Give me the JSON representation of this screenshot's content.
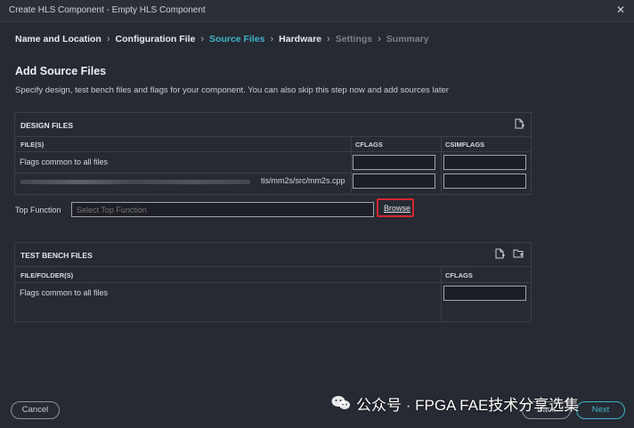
{
  "window": {
    "title": "Create HLS Component - Empty HLS Component"
  },
  "steps": [
    {
      "label": "Name and Location",
      "state": "done"
    },
    {
      "label": "Configuration File",
      "state": "done"
    },
    {
      "label": "Source Files",
      "state": "active"
    },
    {
      "label": "Hardware",
      "state": "done"
    },
    {
      "label": "Settings",
      "state": "pending"
    },
    {
      "label": "Summary",
      "state": "pending"
    }
  ],
  "page": {
    "title": "Add Source Files",
    "description": "Specify design, test bench files and flags for your component. You can also skip this step now and add sources later"
  },
  "design_files": {
    "title": "DESIGN FILES",
    "columns": [
      "FILE(S)",
      "CFLAGS",
      "CSIMFLAGS"
    ],
    "rows": [
      {
        "file": "Flags common to all files",
        "cflags": "",
        "csimflags": ""
      },
      {
        "file": "tis/mm2s/src/mm2s.cpp",
        "cflags": "",
        "csimflags": ""
      }
    ],
    "icon": "add-file-icon"
  },
  "top_function": {
    "label": "Top Function",
    "placeholder": "Select Top Function",
    "browse": "Browse"
  },
  "test_bench_files": {
    "title": "TEST BENCH FILES",
    "columns": [
      "FILE/FOLDER(S)",
      "CFLAGS"
    ],
    "rows": [
      {
        "file": "Flags common to all files",
        "cflags": ""
      }
    ],
    "icons": [
      "add-file-icon",
      "add-folder-icon"
    ]
  },
  "footer": {
    "cancel": "Cancel",
    "back": "Back",
    "next": "Next"
  },
  "watermark": "公众号 · FPGA FAE技术分享选集",
  "colors": {
    "background": "#262a33",
    "accent": "#3fb4c9",
    "highlight": "#d7262e"
  }
}
